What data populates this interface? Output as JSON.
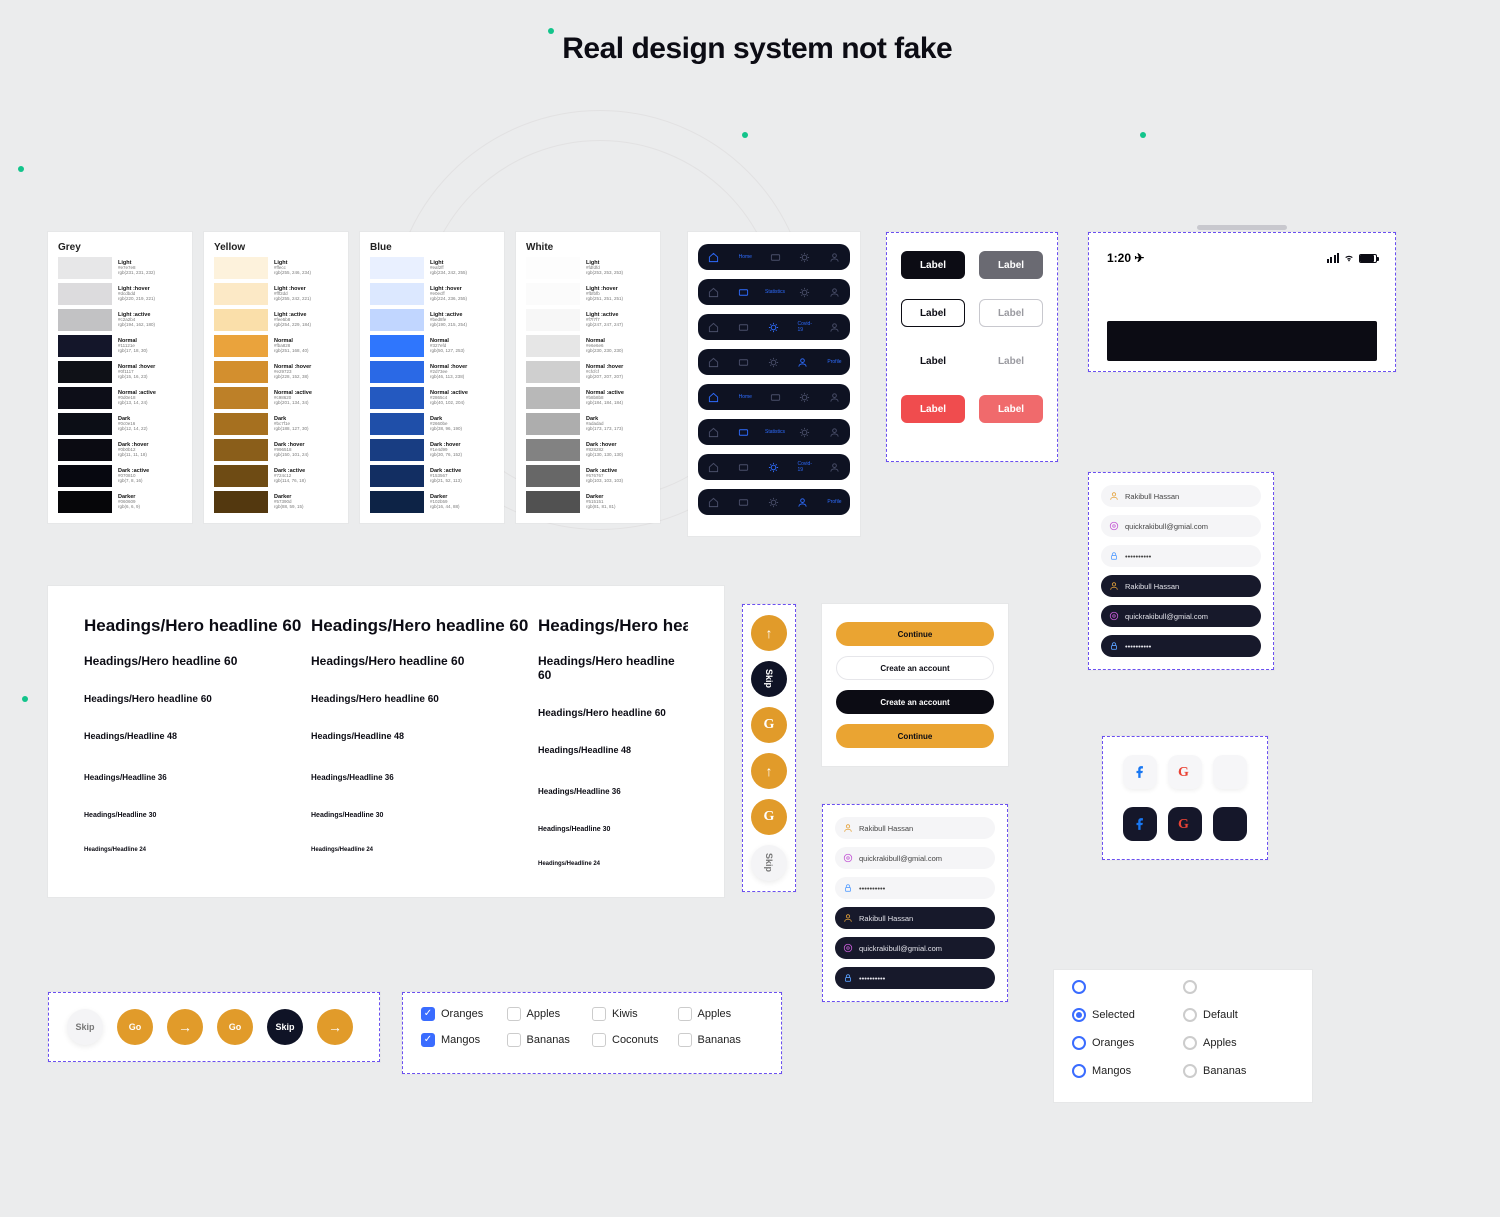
{
  "title": "Real design system not fake",
  "status_time": "1:20",
  "typography": {
    "h60": "Headings/Hero headline 60",
    "h48": "Headings/Headline 48",
    "h36": "Headings/Headline 36",
    "h30": "Headings/Headline 30",
    "h24": "Headings/Headline 24"
  },
  "label": "Label",
  "nav_labels": {
    "home": "Home",
    "statistics": "Statistics",
    "covid": "Covid-19",
    "profile": "Profile"
  },
  "cta": {
    "continue": "Continue",
    "create": "Create an account"
  },
  "circles": {
    "skip": "Skip",
    "go": "Go"
  },
  "inputs": {
    "name": "Rakibull Hassan",
    "email": "quickrakibull@gmial.com",
    "password": "••••••••••",
    "email2": "quickrakibull@gmial.com"
  },
  "checkboxes": [
    "Oranges",
    "Apples",
    "Kiwis",
    "Apples",
    "Mangos",
    "Bananas",
    "Coconuts",
    "Bananas"
  ],
  "checkbox_checked": [
    true,
    false,
    false,
    false,
    true,
    false,
    false,
    false
  ],
  "radios": [
    "",
    "",
    "Selected",
    "Default",
    "Oranges",
    "Apples",
    "Mangos",
    "Bananas"
  ],
  "radio_state": [
    "blue-open",
    "empty",
    "blue-fill",
    "empty",
    "blue-open",
    "empty",
    "blue-open",
    "empty"
  ],
  "colors": {
    "Grey": [
      {
        "name": "Light",
        "hex": "#e7e7e8",
        "rgb": "rgb(231, 231, 232)",
        "c": "#e7e7e8"
      },
      {
        "name": "Light :hover",
        "hex": "#dcdbdd",
        "rgb": "rgb(220, 219, 221)",
        "c": "#dcdbdd"
      },
      {
        "name": "Light :active",
        "hex": "#c2a2b4",
        "rgb": "rgb(194, 162, 180)",
        "c": "#c2c2c4"
      },
      {
        "name": "Normal",
        "hex": "#11121e",
        "rgb": "rgb(17, 18, 30)",
        "c": "#14162a"
      },
      {
        "name": "Normal :hover",
        "hex": "#0f1117",
        "rgb": "rgb(15, 16, 23)",
        "c": "#0f1117"
      },
      {
        "name": "Normal :active",
        "hex": "#0d0e18",
        "rgb": "rgb(13, 14, 24)",
        "c": "#0d0e18"
      },
      {
        "name": "Dark",
        "hex": "#0c0e16",
        "rgb": "rgb(12, 14, 22)",
        "c": "#0c0e16"
      },
      {
        "name": "Dark :hover",
        "hex": "#0b0b12",
        "rgb": "rgb(11, 11, 18)",
        "c": "#0b0b12"
      },
      {
        "name": "Dark :active",
        "hex": "#070810",
        "rgb": "rgb(7, 8, 16)",
        "c": "#070810"
      },
      {
        "name": "Darker",
        "hex": "#060609",
        "rgb": "rgb(6, 6, 9)",
        "c": "#060609"
      }
    ],
    "Yellow": [
      {
        "name": "Light",
        "hex": "#ffecc",
        "rgb": "rgb(255, 246, 234)",
        "c": "#fdf2dc"
      },
      {
        "name": "Light :hover",
        "hex": "#fff2dd",
        "rgb": "rgb(255, 242, 221)",
        "c": "#fce9c6"
      },
      {
        "name": "Light :active",
        "hex": "#fee5b8",
        "rgb": "rgb(254, 229, 184)",
        "c": "#fadfaa"
      },
      {
        "name": "Normal",
        "hex": "#fba828",
        "rgb": "rgb(251, 168, 40)",
        "c": "#eaa33c"
      },
      {
        "name": "Normal :hover",
        "hex": "#e29723",
        "rgb": "rgb(228, 152, 38)",
        "c": "#d38f2e"
      },
      {
        "name": "Normal :active",
        "hex": "#c98620",
        "rgb": "rgb(201, 134, 34)",
        "c": "#bd8028"
      },
      {
        "name": "Dark",
        "hex": "#bc7f1e",
        "rgb": "rgb(188, 127, 30)",
        "c": "#a6701f"
      },
      {
        "name": "Dark :hover",
        "hex": "#996518",
        "rgb": "rgb(150, 101, 24)",
        "c": "#8a5e1a"
      },
      {
        "name": "Dark :active",
        "hex": "#724c12",
        "rgb": "rgb(114, 76, 18)",
        "c": "#6e4b14"
      },
      {
        "name": "Darker",
        "hex": "#57390d",
        "rgb": "rgb(88, 59, 15)",
        "c": "#53380f"
      }
    ],
    "Blue": [
      {
        "name": "Light",
        "hex": "#eaf2ff",
        "rgb": "rgb(234, 242, 255)",
        "c": "#e9f0ff"
      },
      {
        "name": "Light :hover",
        "hex": "#e0ecff",
        "rgb": "rgb(224, 236, 255)",
        "c": "#dce8ff"
      },
      {
        "name": "Light :active",
        "hex": "#bed8fe",
        "rgb": "rgb(190, 215, 254)",
        "c": "#c1d6ff"
      },
      {
        "name": "Normal",
        "hex": "#327efd",
        "rgb": "rgb(50, 127, 253)",
        "c": "#2f76fd"
      },
      {
        "name": "Normal :hover",
        "hex": "#2d73ee",
        "rgb": "rgb(46, 113, 238)",
        "c": "#2a69e6"
      },
      {
        "name": "Normal :active",
        "hex": "#2865c4",
        "rgb": "rgb(40, 102, 204)",
        "c": "#2459c0"
      },
      {
        "name": "Dark",
        "hex": "#2660be",
        "rgb": "rgb(38, 96, 190)",
        "c": "#1f4fa9"
      },
      {
        "name": "Dark :hover",
        "hex": "#1e4d99",
        "rgb": "rgb(30, 76, 152)",
        "c": "#183d82"
      },
      {
        "name": "Dark :active",
        "hex": "#153567",
        "rgb": "rgb(21, 52, 113)",
        "c": "#122e62"
      },
      {
        "name": "Darker",
        "hex": "#102b59",
        "rgb": "rgb(16, 44, 88)",
        "c": "#0d2346"
      }
    ],
    "White": [
      {
        "name": "Light",
        "hex": "#fdfdfd",
        "rgb": "rgb(253, 253, 253)",
        "c": "#fdfdfd"
      },
      {
        "name": "Light :hover",
        "hex": "#fbfbfb",
        "rgb": "rgb(251, 251, 251)",
        "c": "#fbfbfb"
      },
      {
        "name": "Light :active",
        "hex": "#f7f7f7",
        "rgb": "rgb(247, 247, 247)",
        "c": "#f7f7f7"
      },
      {
        "name": "Normal",
        "hex": "#e6e6e6",
        "rgb": "rgb(230, 230, 230)",
        "c": "#e6e6e6"
      },
      {
        "name": "Normal :hover",
        "hex": "#cfcfcf",
        "rgb": "rgb(207, 207, 207)",
        "c": "#cfcfcf"
      },
      {
        "name": "Normal :active",
        "hex": "#b8b8b8",
        "rgb": "rgb(184, 184, 184)",
        "c": "#b8b8b8"
      },
      {
        "name": "Dark",
        "hex": "#adadad",
        "rgb": "rgb(173, 173, 173)",
        "c": "#adadad"
      },
      {
        "name": "Dark :hover",
        "hex": "#828282",
        "rgb": "rgb(130, 130, 130)",
        "c": "#828282"
      },
      {
        "name": "Dark :active",
        "hex": "#676767",
        "rgb": "rgb(103, 103, 103)",
        "c": "#676767"
      },
      {
        "name": "Darker",
        "hex": "#515151",
        "rgb": "rgb(81, 81, 81)",
        "c": "#515151"
      }
    ]
  }
}
